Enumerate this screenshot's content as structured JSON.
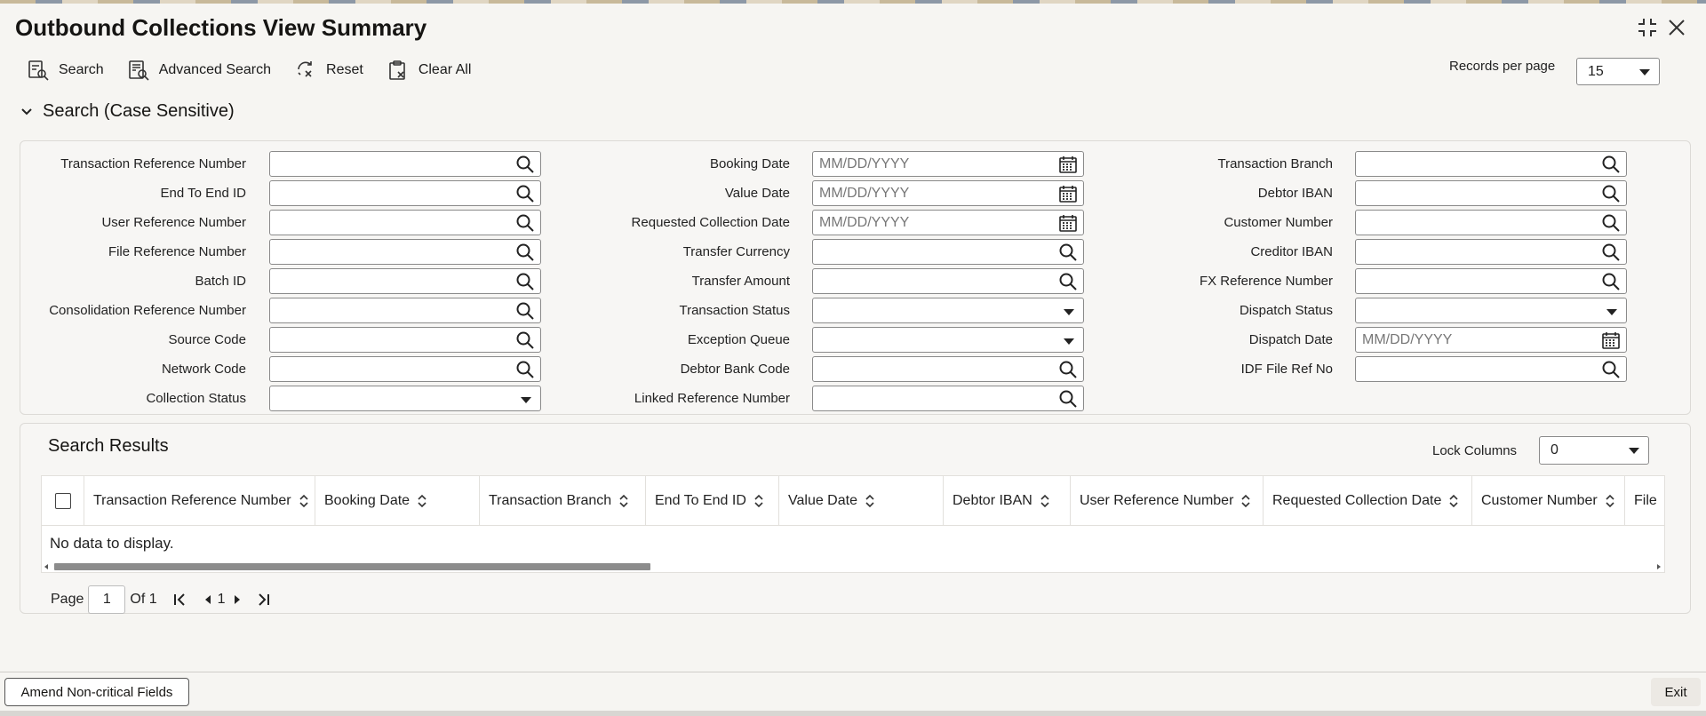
{
  "header": {
    "title": "Outbound Collections View Summary"
  },
  "toolbar": {
    "search": "Search",
    "advanced_search": "Advanced Search",
    "reset": "Reset",
    "clear_all": "Clear All",
    "records_per_page_label": "Records per page",
    "records_per_page_value": "15"
  },
  "search_section": {
    "title": "Search (Case Sensitive)"
  },
  "fields": {
    "col1": [
      {
        "label": "Transaction Reference Number",
        "type": "lookup"
      },
      {
        "label": "End To End ID",
        "type": "lookup"
      },
      {
        "label": "User Reference Number",
        "type": "lookup"
      },
      {
        "label": "File Reference Number",
        "type": "lookup"
      },
      {
        "label": "Batch ID",
        "type": "lookup"
      },
      {
        "label": "Consolidation Reference Number",
        "type": "lookup"
      },
      {
        "label": "Source Code",
        "type": "lookup"
      },
      {
        "label": "Network Code",
        "type": "lookup"
      },
      {
        "label": "Collection Status",
        "type": "select"
      }
    ],
    "col2": [
      {
        "label": "Booking Date",
        "type": "date",
        "placeholder": "MM/DD/YYYY"
      },
      {
        "label": "Value Date",
        "type": "date",
        "placeholder": "MM/DD/YYYY"
      },
      {
        "label": "Requested Collection Date",
        "type": "date",
        "placeholder": "MM/DD/YYYY"
      },
      {
        "label": "Transfer Currency",
        "type": "lookup"
      },
      {
        "label": "Transfer Amount",
        "type": "lookup"
      },
      {
        "label": "Transaction Status",
        "type": "select"
      },
      {
        "label": "Exception Queue",
        "type": "select"
      },
      {
        "label": "Debtor Bank Code",
        "type": "lookup"
      },
      {
        "label": "Linked Reference Number",
        "type": "lookup"
      }
    ],
    "col3": [
      {
        "label": "Transaction Branch",
        "type": "lookup"
      },
      {
        "label": "Debtor IBAN",
        "type": "lookup"
      },
      {
        "label": "Customer Number",
        "type": "lookup"
      },
      {
        "label": "Creditor IBAN",
        "type": "lookup"
      },
      {
        "label": "FX Reference Number",
        "type": "lookup"
      },
      {
        "label": "Dispatch Status",
        "type": "select"
      },
      {
        "label": "Dispatch Date",
        "type": "date",
        "placeholder": "MM/DD/YYYY"
      },
      {
        "label": "IDF File Ref No",
        "type": "lookup"
      }
    ]
  },
  "results": {
    "title": "Search Results",
    "lock_columns_label": "Lock Columns",
    "lock_columns_value": "0",
    "columns": [
      "Transaction Reference Number",
      "Booking Date",
      "Transaction Branch",
      "End To End ID",
      "Value Date",
      "Debtor IBAN",
      "User Reference Number",
      "Requested Collection Date",
      "Customer Number",
      "File"
    ],
    "empty_message": "No data to display."
  },
  "pager": {
    "page_label": "Page",
    "page_value": "1",
    "of_label": "Of 1",
    "current": "1"
  },
  "footer": {
    "amend": "Amend Non-critical Fields",
    "exit": "Exit"
  }
}
